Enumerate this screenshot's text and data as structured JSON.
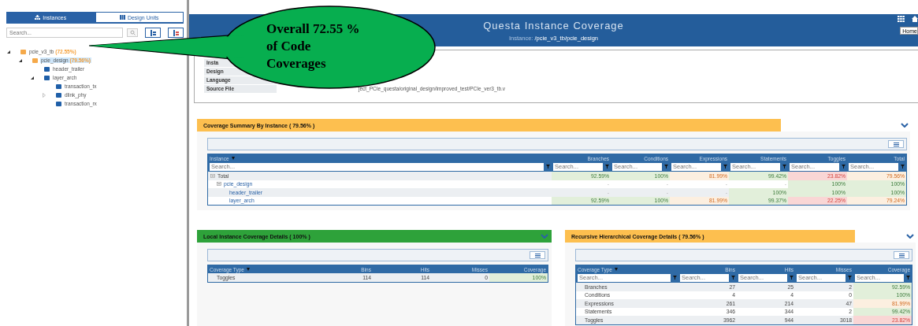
{
  "sidebar": {
    "tabs": [
      {
        "label": "Instances",
        "selected": true
      },
      {
        "label": "Design Units",
        "selected": false
      }
    ],
    "search": {
      "placeholder": "Search..."
    },
    "tree": [
      {
        "label": "pcie_v3_tb",
        "percent": "(72.55%)",
        "color": "#f5a94a",
        "selected": false,
        "expanded": true,
        "children": [
          {
            "label": "pcie_design",
            "percent": "(79.56%)",
            "color": "#f5a94a",
            "selected": true,
            "expanded": true,
            "children": [
              {
                "label": "header_trailer",
                "color": "#1f5fa8",
                "selected": false
              },
              {
                "label": "layer_arch",
                "color": "#1f5fa8",
                "selected": false,
                "expanded": true,
                "children": [
                  {
                    "label": "transaction_tx",
                    "color": "#1f5fa8",
                    "selected": false
                  },
                  {
                    "label": "dlink_phy",
                    "color": "#1f5fa8",
                    "selected": false,
                    "expanded": false
                  },
                  {
                    "label": "transaction_rx",
                    "color": "#1f5fa8",
                    "selected": false
                  }
                ]
              }
            ]
          }
        ]
      }
    ]
  },
  "header": {
    "title": "Questa Instance Coverage",
    "instance_label": "Instance:",
    "instance_path": "/pcie_v3_tb/pcie_design",
    "home_button": "Home"
  },
  "info": [
    {
      "label": "Insta"
    },
    {
      "label": "Design"
    },
    {
      "label": "Language"
    },
    {
      "label": "Source File",
      "value": "ject_PCIe_questa/original_design/improved_test/PCIe_ver3_tb.v"
    }
  ],
  "callout": {
    "text": "Overall 72.55 % of Code Coverages"
  },
  "summary": {
    "title": "Coverage Summary By Instance ( 79.56% )",
    "color": "#fdbf4f",
    "columns": [
      "Instance",
      "Branches",
      "Conditions",
      "Expressions",
      "Statements",
      "Toggles",
      "Total"
    ],
    "search_placeholders": [
      "Search...",
      "Search...",
      "Search...",
      "Search...",
      "Search...",
      "Search...",
      "Search..."
    ],
    "rows": [
      {
        "cells": [
          {
            "text": "Total"
          },
          {
            "text": "92.59%",
            "color": "#e2efda"
          },
          {
            "text": "100%",
            "color": "#e2efda"
          },
          {
            "text": "81.99%",
            "color": "#fcefe0"
          },
          {
            "text": "99.42%",
            "color": "#e2efda"
          },
          {
            "text": "23.82%",
            "color": "#f9d6d5"
          },
          {
            "text": "79.56%",
            "color": "#fcefe0"
          }
        ],
        "expanded": true,
        "children": [
          {
            "cells": [
              {
                "text": "pcie_design"
              },
              {
                "text": "-"
              },
              {
                "text": "-"
              },
              {
                "text": "-"
              },
              {
                "text": "-"
              },
              {
                "text": "100%",
                "color": "#e2efda"
              },
              {
                "text": "100%",
                "color": "#e2efda"
              }
            ],
            "expanded": true,
            "children": [
              {
                "cells": [
                  {
                    "text": "header_trailer"
                  },
                  {
                    "text": "-"
                  },
                  {
                    "text": "-"
                  },
                  {
                    "text": "-"
                  },
                  {
                    "text": "100%",
                    "color": "#e2efda"
                  },
                  {
                    "text": "100%",
                    "color": "#e2efda"
                  },
                  {
                    "text": "100%",
                    "color": "#e2efda"
                  }
                ]
              },
              {
                "cells": [
                  {
                    "text": "layer_arch"
                  },
                  {
                    "text": "92.59%",
                    "color": "#e2efda"
                  },
                  {
                    "text": "100%",
                    "color": "#e2efda"
                  },
                  {
                    "text": "81.99%",
                    "color": "#fcefe0"
                  },
                  {
                    "text": "99.37%",
                    "color": "#e2efda"
                  },
                  {
                    "text": "22.25%",
                    "color": "#f9d6d5"
                  },
                  {
                    "text": "79.24%",
                    "color": "#fcefe0"
                  }
                ]
              }
            ]
          }
        ]
      }
    ]
  },
  "local": {
    "title": "Local Instance Coverage Details ( 100% )",
    "color": "#2ea23a",
    "columns": [
      "Coverage Type",
      "Bins",
      "Hits",
      "Misses",
      "Coverage"
    ],
    "rows": [
      {
        "cells": [
          {
            "text": "Toggles"
          },
          {
            "text": "114"
          },
          {
            "text": "114"
          },
          {
            "text": "0"
          },
          {
            "text": "100%",
            "color": "#e2efda"
          }
        ]
      }
    ]
  },
  "recursive": {
    "title": "Recursive Hierarchical Coverage Details ( 79.56% )",
    "color": "#fdbf4f",
    "columns": [
      "Coverage Type",
      "Bins",
      "Hits",
      "Misses",
      "Coverage"
    ],
    "search_placeholders": [
      "Search...",
      "Search...",
      "Search...",
      "Search...",
      "Search..."
    ],
    "rows": [
      {
        "cells": [
          {
            "text": "Branches"
          },
          {
            "text": "27"
          },
          {
            "text": "25"
          },
          {
            "text": "2"
          },
          {
            "text": "92.59%",
            "color": "#e2efda"
          }
        ]
      },
      {
        "cells": [
          {
            "text": "Conditions"
          },
          {
            "text": "4"
          },
          {
            "text": "4"
          },
          {
            "text": "0"
          },
          {
            "text": "100%",
            "color": "#e2efda"
          }
        ]
      },
      {
        "cells": [
          {
            "text": "Expressions"
          },
          {
            "text": "261"
          },
          {
            "text": "214"
          },
          {
            "text": "47"
          },
          {
            "text": "81.99%",
            "color": "#fcefe0"
          }
        ]
      },
      {
        "cells": [
          {
            "text": "Statements"
          },
          {
            "text": "346"
          },
          {
            "text": "344"
          },
          {
            "text": "2"
          },
          {
            "text": "99.42%",
            "color": "#e2efda"
          }
        ]
      },
      {
        "cells": [
          {
            "text": "Toggles"
          },
          {
            "text": "3962"
          },
          {
            "text": "944"
          },
          {
            "text": "3018"
          },
          {
            "text": "23.82%",
            "color": "#f9d6d5"
          }
        ]
      }
    ]
  }
}
